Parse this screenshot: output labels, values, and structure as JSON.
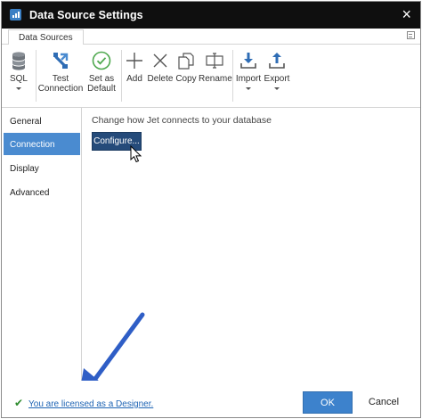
{
  "window": {
    "title": "Data Source Settings",
    "close_glyph": "×"
  },
  "tabs": [
    {
      "label": "Data Sources"
    }
  ],
  "ribbon": {
    "sql": {
      "label": "SQL",
      "icon": "database-icon"
    },
    "test_connection": {
      "line1": "Test",
      "line2": "Connection",
      "icon": "test-connection-icon"
    },
    "set_as_default": {
      "line1": "Set as",
      "line2": "Default",
      "icon": "checkmark-circle-icon"
    },
    "add": {
      "label": "Add",
      "icon": "plus-icon"
    },
    "delete": {
      "label": "Delete",
      "icon": "x-icon"
    },
    "copy": {
      "label": "Copy",
      "icon": "copy-icon"
    },
    "rename": {
      "label": "Rename",
      "icon": "rename-icon"
    },
    "import": {
      "label": "Import",
      "icon": "import-icon"
    },
    "export": {
      "label": "Export",
      "icon": "export-icon"
    }
  },
  "sidebar": {
    "items": [
      {
        "label": "General",
        "active": false
      },
      {
        "label": "Connection",
        "active": true
      },
      {
        "label": "Display",
        "active": false
      },
      {
        "label": "Advanced",
        "active": false
      }
    ]
  },
  "content": {
    "heading": "Change how Jet connects to your database",
    "configure_label": "Configure..."
  },
  "footer": {
    "license_text": "You are licensed as a Designer.",
    "ok_label": "OK",
    "cancel_label": "Cancel"
  },
  "colors": {
    "titlebar": "#0f0f0f",
    "active_nav": "#4a8bd0",
    "configure_button": "#254b7a",
    "ok_button": "#3d82cc",
    "annotation_arrow": "#2f5ec6",
    "license_link": "#1e64b4"
  }
}
